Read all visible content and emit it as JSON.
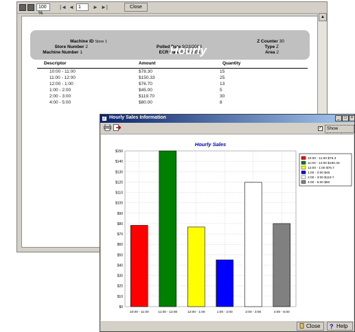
{
  "report_viewer": {
    "toolbar": {
      "zoom_value": "100 %",
      "page_value": "1",
      "nav_first": "|◄",
      "nav_prev": "◄",
      "nav_next": "►",
      "nav_last": "►|",
      "close_label": "Close"
    },
    "report": {
      "title": "Hourly",
      "header_left": [
        {
          "label": "Machine ID",
          "value": "Store 1"
        },
        {
          "label": "Store Number",
          "value": "2"
        },
        {
          "label": "Machine Number",
          "value": "1"
        }
      ],
      "header_mid": [
        {
          "label": "Polled Date",
          "value": "9/23/2004"
        },
        {
          "label": "ECR Date",
          "value": "9/23/2004"
        }
      ],
      "header_right": [
        {
          "label": "Z Counter",
          "value": "30"
        },
        {
          "label": "Type",
          "value": "Z"
        },
        {
          "label": "Area",
          "value": "2"
        }
      ],
      "columns": [
        "Descriptor",
        "Amount",
        "Quantity"
      ],
      "rows": [
        {
          "descriptor": "10:00 - 11:00",
          "amount": "$78.30",
          "quantity": "15"
        },
        {
          "descriptor": "11:00 - 12:00",
          "amount": "$150.33",
          "quantity": "25"
        },
        {
          "descriptor": "12:00 - 1:00",
          "amount": "$76.70",
          "quantity": "13"
        },
        {
          "descriptor": "1:00 - 2:00",
          "amount": "$45.00",
          "quantity": "5"
        },
        {
          "descriptor": "2:00 - 3:00",
          "amount": "$119.70",
          "quantity": "30"
        },
        {
          "descriptor": "4:00 - 5:00",
          "amount": "$80.00",
          "quantity": "8"
        }
      ]
    }
  },
  "sales_window": {
    "title": "Hourly Sales Information",
    "show_legend_label": "Show Legend",
    "show_legend_checked": true,
    "close_label": "Close",
    "help_label": "Help",
    "icons": {
      "print": "printer-icon",
      "export": "export-icon",
      "close": "close-icon",
      "help": "help-icon"
    }
  },
  "chart_data": {
    "type": "bar",
    "title": "Hourly Sales",
    "categories": [
      "10:00 - 11:00",
      "11:00 - 12:00",
      "12:00 - 1:00",
      "1:00 - 2:00",
      "2:00 - 3:00",
      "4:00 - 5:00"
    ],
    "values": [
      78.3,
      150.33,
      76.7,
      45,
      119.7,
      80
    ],
    "colors": [
      "#ff0000",
      "#008000",
      "#ffff00",
      "#0000ff",
      "#ffffff",
      "#808080"
    ],
    "legend": [
      "10:00 - 11:00 $78.3",
      "11:00 - 12:00 $150.33",
      "12:00 - 1:00 $76.7",
      "1:00 - 2:00 $45",
      "2:00 - 3:00 $119.7",
      "4:00 - 5:00 $80"
    ],
    "ylim": [
      0,
      150
    ],
    "ytick_step": 10,
    "ytick_prefix": "$",
    "grid": true,
    "legend_position": "right"
  }
}
